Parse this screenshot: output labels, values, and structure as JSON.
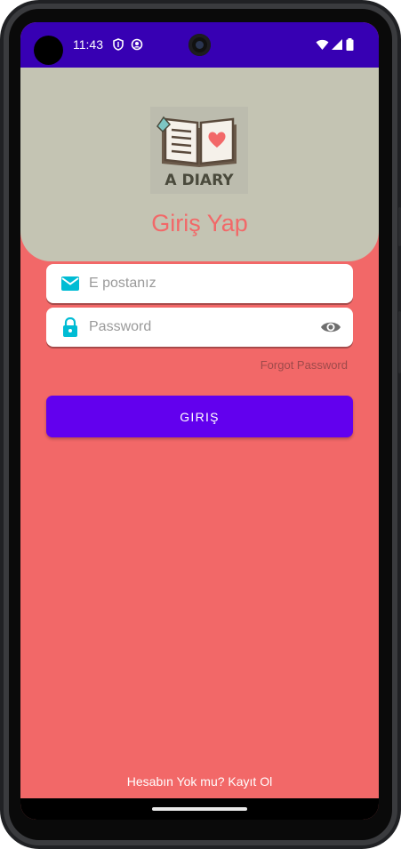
{
  "status_bar": {
    "time": "11:43",
    "background": "#3700b3",
    "icons": [
      "shield-icon",
      "vpn-icon",
      "wifi-icon",
      "signal-icon",
      "battery-icon"
    ]
  },
  "header": {
    "logo_text": "A DIARY",
    "title": "Giriş Yap",
    "background": "#c4c4b3",
    "title_color": "#f26868"
  },
  "form": {
    "email": {
      "placeholder": "E postanız",
      "value": "",
      "icon": "mail-icon"
    },
    "password": {
      "placeholder": "Password",
      "value": "",
      "icon": "lock-icon",
      "toggle_icon": "eye-icon"
    },
    "forgot_password": "Forgot Password",
    "login_button": "GIRIŞ"
  },
  "footer": {
    "signup_text": "Hesabın Yok mu? Kayıt Ol"
  },
  "colors": {
    "page_background": "#f26868",
    "accent": "#6200ee",
    "icon_tint": "#00bcd4"
  }
}
